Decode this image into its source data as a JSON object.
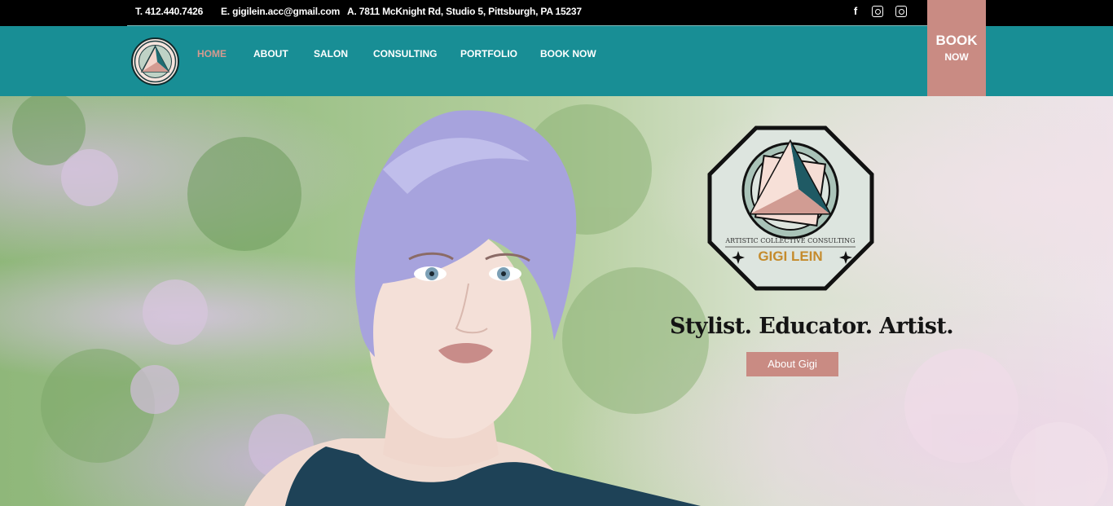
{
  "topbar": {
    "phone": "T. 412.440.7426",
    "email": "E. gigilein.acc@gmail.com",
    "address": "A. 7811 McKnight Rd, Studio 5, Pittsburgh, PA 15237",
    "social": [
      {
        "icon": "facebook-icon",
        "glyph": "f"
      },
      {
        "icon": "instagram-icon",
        "glyph": ""
      },
      {
        "icon": "instagram-icon",
        "glyph": ""
      }
    ]
  },
  "nav": {
    "items": [
      {
        "label": "HOME",
        "active": true
      },
      {
        "label": "ABOUT",
        "active": false
      },
      {
        "label": "SALON",
        "active": false
      },
      {
        "label": "CONSULTING",
        "active": false
      },
      {
        "label": "PORTFOLIO",
        "active": false
      },
      {
        "label": "BOOK NOW",
        "active": false
      }
    ],
    "book_tab": {
      "line1": "BOOK",
      "line2": "NOW"
    }
  },
  "hero": {
    "logo_text_top": "ARTISTIC COLLECTIVE CONSULTING",
    "logo_text_main": "GIGI LEIN",
    "tagline": "Stylist. Educator. Artist.",
    "button_label": "About Gigi"
  },
  "colors": {
    "topbar": "#000000",
    "navbar": "#188e95",
    "accent": "#c98b83",
    "active_nav": "#d49a90"
  }
}
